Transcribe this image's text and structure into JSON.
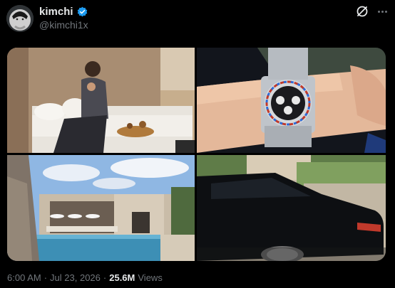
{
  "author": {
    "display_name": "kimchi",
    "handle": "@kimchi1x",
    "verified": true,
    "verified_color": "#1d9bf0"
  },
  "icons": {
    "header_action": "grok-icon",
    "more": "more-options-icon"
  },
  "media": [
    {
      "kind": "photo",
      "subject": "man sitting on white bench indoors"
    },
    {
      "kind": "photo",
      "subject": "wrist with chronograph watch"
    },
    {
      "kind": "photo",
      "subject": "modern villa with swimming pool"
    },
    {
      "kind": "photo",
      "subject": "black car parked in courtyard"
    }
  ],
  "meta": {
    "time": "6:00 AM",
    "separator": "·",
    "date": "Jul 23, 2026",
    "views_count": "25.6M",
    "views_label": "Views"
  },
  "colors": {
    "background": "#000000",
    "primary_text": "#e7e9ea",
    "secondary_text": "#71767b"
  }
}
